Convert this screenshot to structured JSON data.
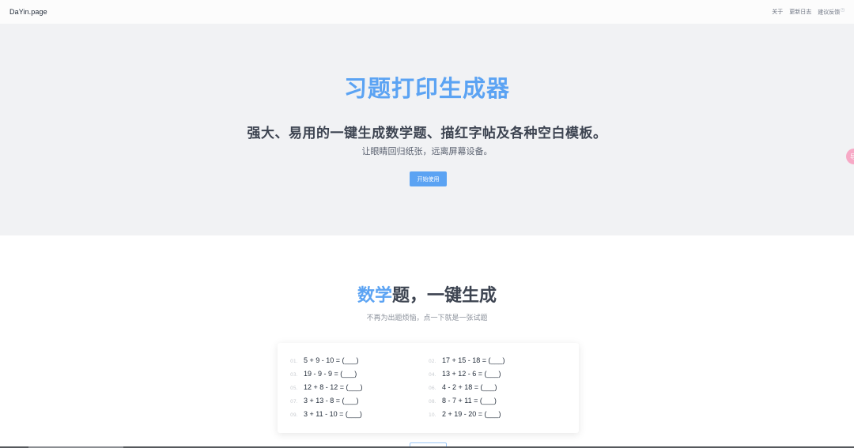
{
  "navbar": {
    "brand": "DaYin.page",
    "links": [
      "关于",
      "更新日志",
      "建议反馈"
    ]
  },
  "hero": {
    "title": "习题打印生成器",
    "subtitle": "强大、易用的一键生成数学题、描红字帖及各种空白模板。",
    "subtitle2": "让眼睛回归纸张，远离屏幕设备。",
    "start_label": "开始使用"
  },
  "side_widget": {
    "label": "导"
  },
  "math_section": {
    "title_accent": "数学",
    "title_rest": "题，一键生成",
    "subtitle": "不再为出题烦恼，点一下就是一张试题",
    "problems": [
      {
        "num": "01.",
        "expr": "5 + 9 - 10 = (___)"
      },
      {
        "num": "02.",
        "expr": "17 + 15 - 18 = (___)"
      },
      {
        "num": "03.",
        "expr": "19 - 9 - 9 = (___)"
      },
      {
        "num": "04.",
        "expr": "13 + 12 - 6 = (___)"
      },
      {
        "num": "05.",
        "expr": "12 + 8 - 12 = (___)"
      },
      {
        "num": "06.",
        "expr": "4 - 2 + 18 = (___)"
      },
      {
        "num": "07.",
        "expr": "3 + 13 - 8 = (___)"
      },
      {
        "num": "08.",
        "expr": "8 - 7 + 11 = (___)"
      },
      {
        "num": "09.",
        "expr": "3 + 11 - 10 = (___)"
      },
      {
        "num": "10.",
        "expr": "2 + 19 - 20 = (___)"
      }
    ]
  },
  "colors": {
    "accent": "#5ba3f3",
    "hero_bg": "#f1f2f4",
    "text_dark": "#3d4451"
  }
}
